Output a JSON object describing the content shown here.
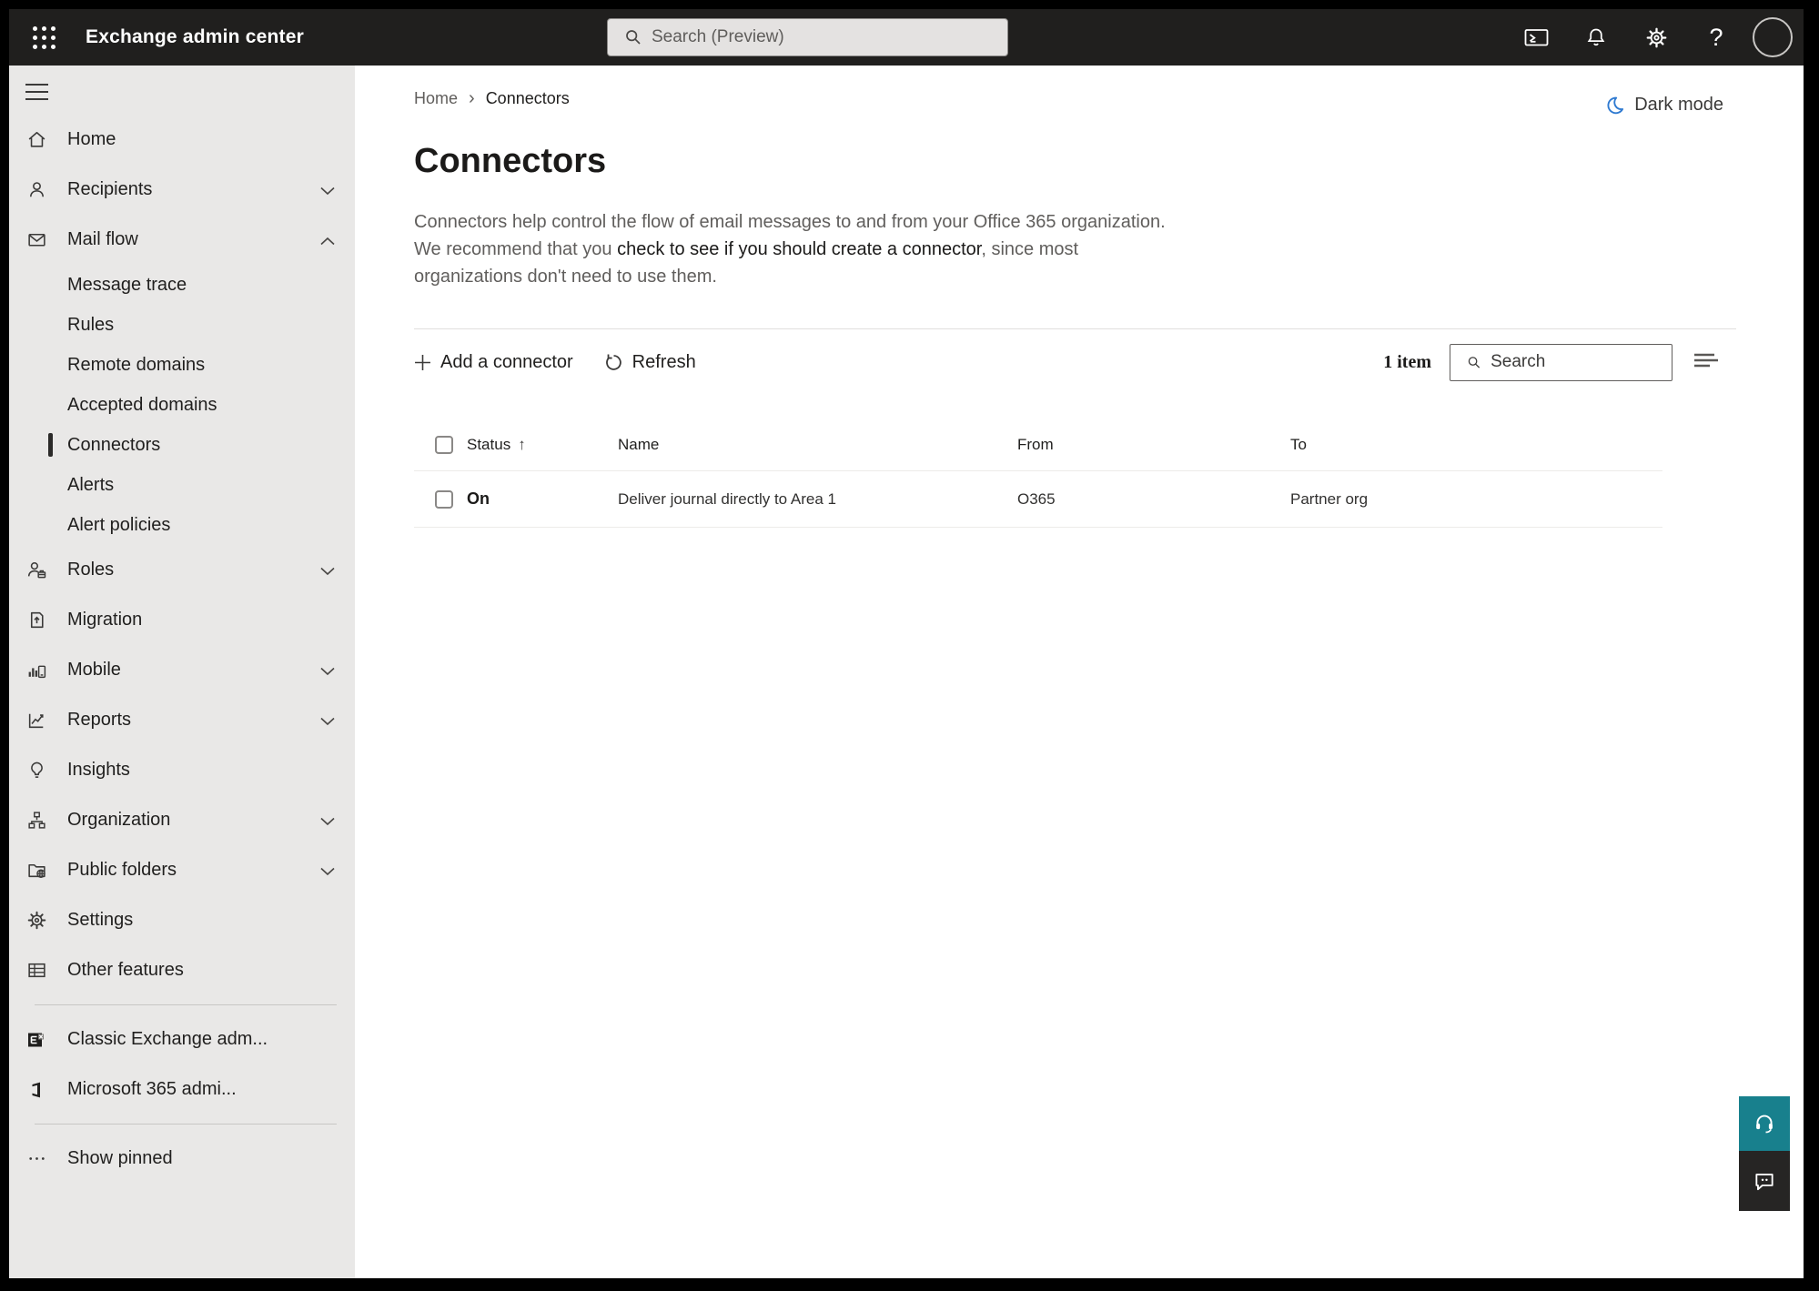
{
  "topbar": {
    "title": "Exchange admin center",
    "search_placeholder": "Search (Preview)"
  },
  "sidebar": {
    "items": [
      {
        "label": "Home"
      },
      {
        "label": "Recipients"
      },
      {
        "label": "Mail flow"
      },
      {
        "label": "Message trace"
      },
      {
        "label": "Rules"
      },
      {
        "label": "Remote domains"
      },
      {
        "label": "Accepted domains"
      },
      {
        "label": "Connectors"
      },
      {
        "label": "Alerts"
      },
      {
        "label": "Alert policies"
      },
      {
        "label": "Roles"
      },
      {
        "label": "Migration"
      },
      {
        "label": "Mobile"
      },
      {
        "label": "Reports"
      },
      {
        "label": "Insights"
      },
      {
        "label": "Organization"
      },
      {
        "label": "Public folders"
      },
      {
        "label": "Settings"
      },
      {
        "label": "Other features"
      },
      {
        "label": "Classic Exchange adm..."
      },
      {
        "label": "Microsoft 365 admi..."
      },
      {
        "label": "Show pinned"
      }
    ]
  },
  "breadcrumb": {
    "home": "Home",
    "separator": "›",
    "current": "Connectors"
  },
  "dark_mode": {
    "label": "Dark mode"
  },
  "page": {
    "title": "Connectors",
    "desc_before": "Connectors help control the flow of email messages to and from your Office 365 organization. We recommend that you ",
    "desc_link": "check to see if you should create a connector",
    "desc_after": ", since most organizations don't need to use them."
  },
  "toolbar": {
    "add_label": "Add a connector",
    "refresh_label": "Refresh",
    "count_label": "1 item",
    "search_placeholder": "Search"
  },
  "table": {
    "headers": {
      "status": "Status",
      "name": "Name",
      "from": "From",
      "to": "To"
    },
    "sort_indicator": "↑",
    "rows": [
      {
        "status": "On",
        "name": "Deliver journal directly to Area 1",
        "from": "O365",
        "to": "Partner org"
      }
    ]
  },
  "colors": {
    "topbar_bg": "#201f1e",
    "sidebar_bg": "#e9e8e7",
    "selected_indicator": "#2b2a29",
    "accent_teal": "#18808d",
    "feedback_dark": "#262524",
    "moon_blue": "#2f7ad1"
  }
}
